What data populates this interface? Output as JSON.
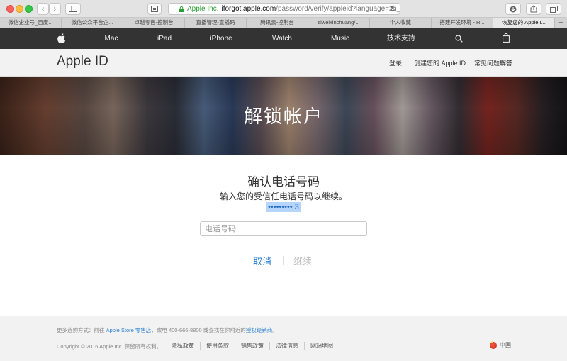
{
  "browser": {
    "url_secure_label": "Apple Inc.",
    "url_host": "iforgot.apple.com",
    "url_path": "/password/verify/appleid?language=zh_CN",
    "tabs": [
      {
        "label": "微信企业号_百度..."
      },
      {
        "label": "微信公众平台企..."
      },
      {
        "label": "卓越零售-控制台"
      },
      {
        "label": "直播管理-直播码"
      },
      {
        "label": "腾讯云-控制台"
      },
      {
        "label": "siweixinchuang/..."
      },
      {
        "label": "个人收藏"
      },
      {
        "label": "搭建开发环境 - R..."
      },
      {
        "label": "恢复您的 Apple I..."
      }
    ],
    "tab_add": "+"
  },
  "nav": {
    "items": [
      "Mac",
      "iPad",
      "iPhone",
      "Watch",
      "Music",
      "技术支持"
    ]
  },
  "subnav": {
    "brand": "Apple ID",
    "links": [
      "登录",
      "创建您的 Apple ID",
      "常见问题解答"
    ]
  },
  "hero": {
    "title": "解锁帐户"
  },
  "content": {
    "title": "确认电话号码",
    "subtitle": "输入您的受信任电话号码以继续。",
    "masked_number": "•••••••••  3",
    "phone_placeholder": "电话号码",
    "cancel_label": "取消",
    "continue_label": "继续"
  },
  "footer": {
    "shop_prefix": "更多选购方式：前往 ",
    "shop_link": "Apple Store 零售店",
    "shop_middle": "，致电 400-666-8800 或查找在你附近的",
    "shop_link2": "授权经销商",
    "shop_suffix": "。",
    "copyright": "Copyright © 2016 Apple Inc. 保留所有权利。",
    "links": [
      "隐私政策",
      "使用条款",
      "销售政策",
      "法律信息",
      "网站地图"
    ],
    "region": "中国"
  }
}
